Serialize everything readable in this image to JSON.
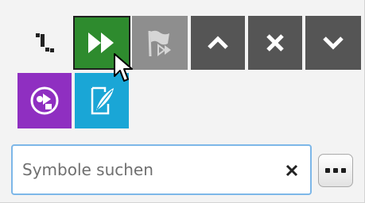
{
  "toolbar": {
    "buttons": [
      {
        "name": "step-back-icon"
      },
      {
        "name": "fast-forward-icon",
        "color": "#2e8b2e"
      },
      {
        "name": "flag-trace-icon",
        "color": "#8e8e8e"
      },
      {
        "name": "chevron-up-icon",
        "color": "#555555"
      },
      {
        "name": "close-icon",
        "color": "#555555"
      },
      {
        "name": "chevron-down-icon",
        "color": "#555555"
      },
      {
        "name": "graph-circle-icon",
        "color": "#8f2fc1"
      },
      {
        "name": "quill-edit-icon",
        "color": "#1aa6d6"
      }
    ]
  },
  "search": {
    "placeholder": "Symbole suchen",
    "value": "",
    "clear_icon": "close-icon",
    "more_icon": "ellipsis-icon"
  },
  "colors": {
    "panel_bg": "#f3f3f3",
    "focus_border": "#7db7e8"
  }
}
